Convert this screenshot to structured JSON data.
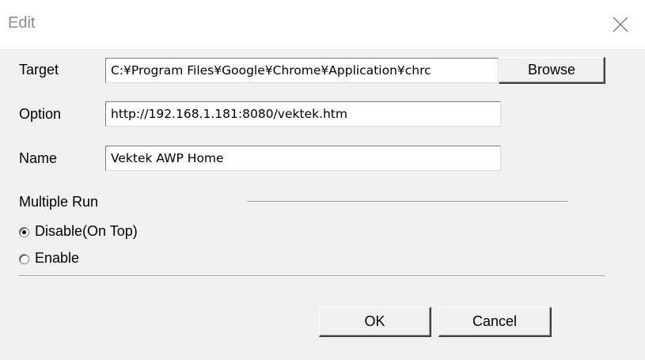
{
  "window": {
    "title": "Edit"
  },
  "form": {
    "target_label": "Target",
    "target_value": "C:¥Program Files¥Google¥Chrome¥Application¥chrc",
    "browse_label": "Browse",
    "option_label": "Option",
    "option_value": "http://192.168.1.181:8080/vektek.htm",
    "name_label": "Name",
    "name_value": "Vektek AWP Home"
  },
  "multiple_run": {
    "label": "Multiple Run",
    "options": [
      {
        "label": "Disable(On Top)",
        "selected": true
      },
      {
        "label": "Enable",
        "selected": false
      }
    ]
  },
  "buttons": {
    "ok_label": "OK",
    "cancel_label": "Cancel"
  },
  "colors": {
    "dialog_bg": "#f0f0f0",
    "title_text": "#8a8a8a"
  }
}
